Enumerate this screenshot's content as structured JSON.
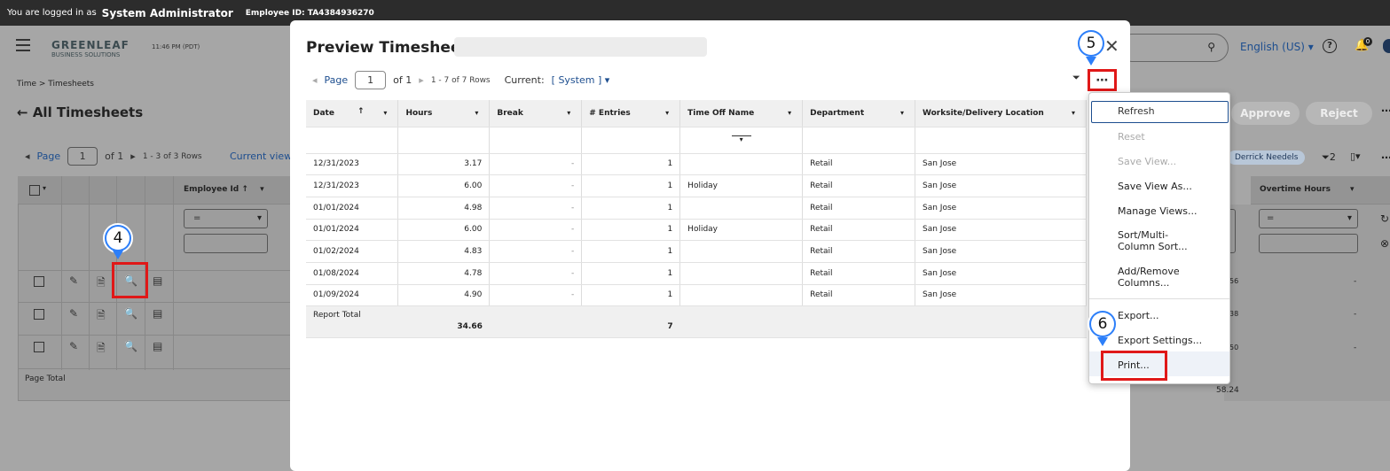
{
  "topbar": {
    "logged_in_label": "You are logged in as",
    "user_name": "System Administrator",
    "employee_id": "Employee ID: TA4384936270"
  },
  "header": {
    "logo_main": "GREENLEAF",
    "logo_sub": "BUSINESS SOLUTIONS",
    "time": "11:46 PM (PDT)",
    "language": "English (US)",
    "notification_count": "0"
  },
  "breadcrumb": "Time > Timesheets",
  "page_title": "All Timesheets",
  "bg_pager": {
    "page_label": "Page",
    "page_value": "1",
    "of_label": "of 1",
    "rows": "1 - 3 of 3 Rows",
    "current_view": "Current view"
  },
  "bg_table": {
    "employee_id_header": "Employee Id",
    "filter_op": "=",
    "page_total": "Page Total",
    "overtime_header": "Overtime Hours",
    "overtime_total": "58.24",
    "row_values": [
      "56",
      "38",
      "50"
    ],
    "dash": "-"
  },
  "bg_actions": {
    "approve": "Approve",
    "reject": "Reject",
    "chip": "Derrick Needels",
    "filter_count": "2"
  },
  "modal": {
    "title": "Preview Timesheet -",
    "pager": {
      "page_label": "Page",
      "page_value": "1",
      "of_label": "of 1",
      "rows": "1 - 7 of 7 Rows",
      "current_label": "Current:",
      "current_value": "[ System ]"
    },
    "columns": [
      "Date",
      "Hours",
      "Break",
      "# Entries",
      "Time Off Name",
      "Department",
      "Worksite/Delivery Location"
    ],
    "rows": [
      [
        "12/31/2023",
        "3.17",
        "-",
        "1",
        "",
        "Retail",
        "San Jose"
      ],
      [
        "12/31/2023",
        "6.00",
        "-",
        "1",
        "Holiday",
        "Retail",
        "San Jose"
      ],
      [
        "01/01/2024",
        "4.98",
        "-",
        "1",
        "",
        "Retail",
        "San Jose"
      ],
      [
        "01/01/2024",
        "6.00",
        "-",
        "1",
        "Holiday",
        "Retail",
        "San Jose"
      ],
      [
        "01/02/2024",
        "4.83",
        "-",
        "1",
        "",
        "Retail",
        "San Jose"
      ],
      [
        "01/08/2024",
        "4.78",
        "-",
        "1",
        "",
        "Retail",
        "San Jose"
      ],
      [
        "01/09/2024",
        "4.90",
        "-",
        "1",
        "",
        "Retail",
        "San Jose"
      ]
    ],
    "totals": {
      "label": "Report Total",
      "hours": "34.66",
      "entries": "7"
    }
  },
  "menu": {
    "refresh": "Refresh",
    "reset": "Reset",
    "save_view": "Save View...",
    "save_view_as": "Save View As...",
    "manage_views": "Manage Views...",
    "sort_1": "Sort/Multi-",
    "sort_2": "Column Sort...",
    "addremove_1": "Add/Remove",
    "addremove_2": "Columns...",
    "export": "Export...",
    "export_settings": "Export Settings...",
    "print": "Print..."
  },
  "markers": {
    "m4": "4",
    "m5": "5",
    "m6": "6"
  }
}
